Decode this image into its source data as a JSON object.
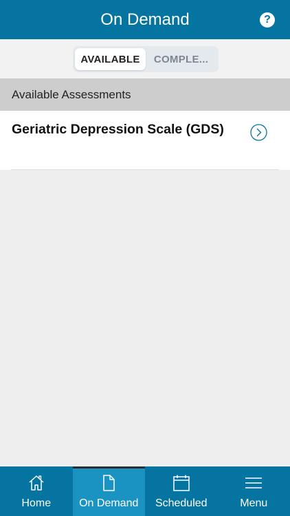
{
  "header": {
    "title": "On Demand",
    "help_icon": "question-circle-icon"
  },
  "segmented_control": {
    "items": [
      {
        "label": "AVAILABLE",
        "selected": true
      },
      {
        "label": "COMPLE...",
        "selected": false
      }
    ]
  },
  "section": {
    "title": "Available Assessments"
  },
  "assessments": [
    {
      "title": "Geriatric Depression Scale (GDS)",
      "icon": "chevron-right-circle-icon"
    }
  ],
  "tabbar": {
    "items": [
      {
        "label": "Home",
        "icon": "home-icon",
        "selected": false
      },
      {
        "label": "On Demand",
        "icon": "document-icon",
        "selected": true
      },
      {
        "label": "Scheduled",
        "icon": "calendar-icon",
        "selected": false
      },
      {
        "label": "Menu",
        "icon": "hamburger-menu-icon",
        "selected": false
      }
    ]
  },
  "colors": {
    "brand": "#0574a0",
    "tab_active": "#1a93c3",
    "background": "#eeeeee",
    "section_header": "#cdcdcd"
  }
}
